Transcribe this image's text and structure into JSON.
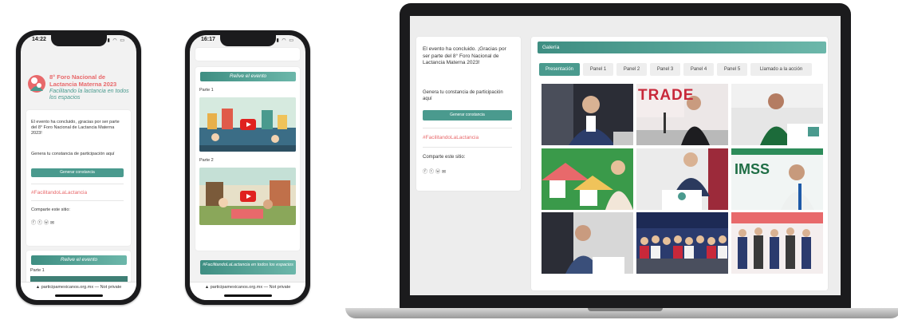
{
  "phone1": {
    "time": "14:22",
    "logo_title": "8° Foro Nacional de Lactancia Materna 2023",
    "logo_subtitle": "Facilitando la lactancia en todos los espacios",
    "message": "El evento ha concluido, ¡gracias por ser parte del 8° Foro Nacional de Lactancia Materna 2023!",
    "certificate_text": "Genera tu constancia de participación aquí",
    "certificate_button": "Generar constancia",
    "hashtag": "#FacilitandoLaLactancia",
    "share_label": "Comparte este sitio:",
    "section_title": "Relive el evento",
    "part_label": "Parte 1",
    "url": "▲ participamexicanos.org.mx — Not private"
  },
  "phone2": {
    "time": "16:17",
    "section_title": "Relive el evento",
    "part1_label": "Parte 1",
    "part2_label": "Parte 2",
    "bottom_section": "#FacilitandoLaLactancia en todos los espacios",
    "url": "▲ participamexicanos.org.mx — Not private"
  },
  "laptop": {
    "message": "El evento ha concluido. ¡Gracias por ser parte del 8° Foro Nacional de Lactancia Materna 2023!",
    "certificate_text": "Genera tu constancia de participación aquí",
    "certificate_button": "Generar constancia",
    "hashtag": "#FacilitandoLaLactancia",
    "share_label": "Comparte este sitio:",
    "gallery_title": "Galería",
    "tabs": [
      "Presentación",
      "Panel 1",
      "Panel 2",
      "Panel 3",
      "Panel 4",
      "Panel 5",
      "Llamado a la acción"
    ],
    "active_tab": 0,
    "photo_banner_text": "TRADE",
    "photo_logo_text": "IMSS"
  },
  "colors": {
    "teal": "#4a9a8e",
    "coral": "#e8696b"
  }
}
